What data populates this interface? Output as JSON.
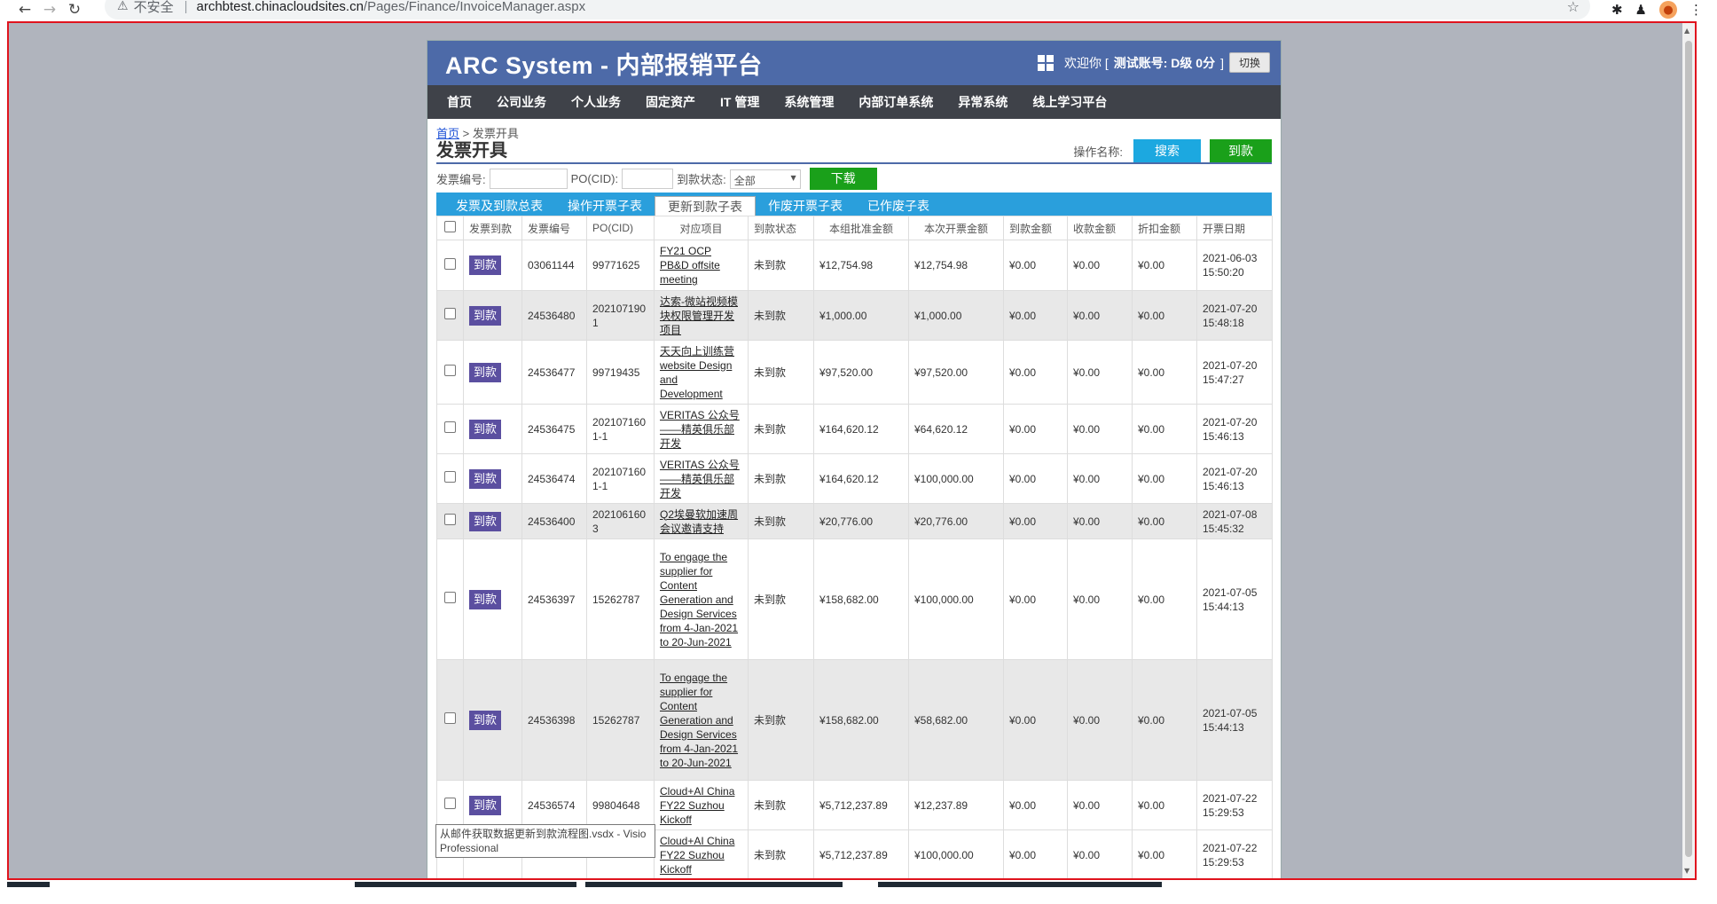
{
  "browser": {
    "insecure_label": "不安全",
    "url_host": "archbtest.chinacloudsites.cn",
    "url_path": "/Pages/Finance/InvoiceManager.aspx"
  },
  "header": {
    "title": "ARC System - 内部报销平台",
    "welcome": "欢迎你 [",
    "account": "测试账号: D级 0分",
    "close_bracket": "]",
    "switch_label": "切换"
  },
  "menu": [
    "首页",
    "公司业务",
    "个人业务",
    "固定资产",
    "IT 管理",
    "系统管理",
    "内部订单系统",
    "异常系统",
    "线上学习平台"
  ],
  "breadcrumb": {
    "home": "首页",
    "sep": " > ",
    "current": "发票开具"
  },
  "page_title": "发票开具",
  "ops": {
    "label": "操作名称:",
    "search": "搜索",
    "arrive": "到款"
  },
  "filter": {
    "invoice_no_label": "发票编号:",
    "po_label": "PO(CID):",
    "status_label": "到款状态:",
    "status_value": "全部",
    "download": "下载"
  },
  "tabs": [
    "发票及到款总表",
    "操作开票子表",
    "更新到款子表",
    "作废开票子表",
    "已作废子表"
  ],
  "table": {
    "headers": [
      "发票到款",
      "发票编号",
      "PO(CID)",
      "对应项目",
      "到款状态",
      "本组批准金额",
      "本次开票金额",
      "到款金额",
      "收款金额",
      "折扣金额",
      "开票日期"
    ],
    "rows": [
      {
        "btn": "到款",
        "invoice": "03061144",
        "po": "99771625",
        "project": "FY21 OCP PB&D offsite meeting",
        "status": "未到款",
        "approved": "¥12,754.98",
        "issued": "¥12,754.98",
        "received": "¥0.00",
        "collected": "¥0.00",
        "discount": "¥0.00",
        "date": "2021-06-03 15:50:20"
      },
      {
        "btn": "到款",
        "invoice": "24536480",
        "po": "2021071901",
        "project": "达索-微站视频模块权限管理开发项目",
        "status": "未到款",
        "approved": "¥1,000.00",
        "issued": "¥1,000.00",
        "received": "¥0.00",
        "collected": "¥0.00",
        "discount": "¥0.00",
        "date": "2021-07-20 15:48:18"
      },
      {
        "btn": "到款",
        "invoice": "24536477",
        "po": "99719435",
        "project": "天天向上训练营website Design and Development",
        "status": "未到款",
        "approved": "¥97,520.00",
        "issued": "¥97,520.00",
        "received": "¥0.00",
        "collected": "¥0.00",
        "discount": "¥0.00",
        "date": "2021-07-20 15:47:27"
      },
      {
        "btn": "到款",
        "invoice": "24536475",
        "po": "2021071601-1",
        "project": "VERITAS 公众号——精英俱乐部开发",
        "status": "未到款",
        "approved": "¥164,620.12",
        "issued": "¥64,620.12",
        "received": "¥0.00",
        "collected": "¥0.00",
        "discount": "¥0.00",
        "date": "2021-07-20 15:46:13"
      },
      {
        "btn": "到款",
        "invoice": "24536474",
        "po": "2021071601-1",
        "project": "VERITAS 公众号——精英俱乐部开发",
        "status": "未到款",
        "approved": "¥164,620.12",
        "issued": "¥100,000.00",
        "received": "¥0.00",
        "collected": "¥0.00",
        "discount": "¥0.00",
        "date": "2021-07-20 15:46:13"
      },
      {
        "btn": "到款",
        "invoice": "24536400",
        "po": "2021061603",
        "project": "Q2埃曼软加速周会议邀请支持",
        "status": "未到款",
        "approved": "¥20,776.00",
        "issued": "¥20,776.00",
        "received": "¥0.00",
        "collected": "¥0.00",
        "discount": "¥0.00",
        "date": "2021-07-08 15:45:32"
      },
      {
        "btn": "到款",
        "invoice": "24536397",
        "po": "15262787",
        "project": "To engage the supplier for Content Generation and Design Services from 4-Jan-2021 to 20-Jun-2021",
        "status": "未到款",
        "approved": "¥158,682.00",
        "issued": "¥100,000.00",
        "received": "¥0.00",
        "collected": "¥0.00",
        "discount": "¥0.00",
        "date": "2021-07-05 15:44:13"
      },
      {
        "btn": "到款",
        "invoice": "24536398",
        "po": "15262787",
        "project": "To engage the supplier for Content Generation and Design Services from 4-Jan-2021 to 20-Jun-2021",
        "status": "未到款",
        "approved": "¥158,682.00",
        "issued": "¥58,682.00",
        "received": "¥0.00",
        "collected": "¥0.00",
        "discount": "¥0.00",
        "date": "2021-07-05 15:44:13"
      },
      {
        "btn": "到款",
        "invoice": "24536574",
        "po": "99804648",
        "project": "Cloud+AI China FY22 Suzhou Kickoff",
        "status": "未到款",
        "approved": "¥5,712,237.89",
        "issued": "¥12,237.89",
        "received": "¥0.00",
        "collected": "¥0.00",
        "discount": "¥0.00",
        "date": "2021-07-22 15:29:53"
      },
      {
        "btn": "",
        "invoice": "",
        "po": "",
        "project": "Cloud+AI China FY22 Suzhou Kickoff",
        "status": "未到款",
        "approved": "¥5,712,237.89",
        "issued": "¥100,000.00",
        "received": "¥0.00",
        "collected": "¥0.00",
        "discount": "¥0.00",
        "date": "2021-07-22 15:29:53"
      }
    ]
  },
  "tooltip": "从邮件获取数据更新到款流程图.vsdx - Visio Professional"
}
